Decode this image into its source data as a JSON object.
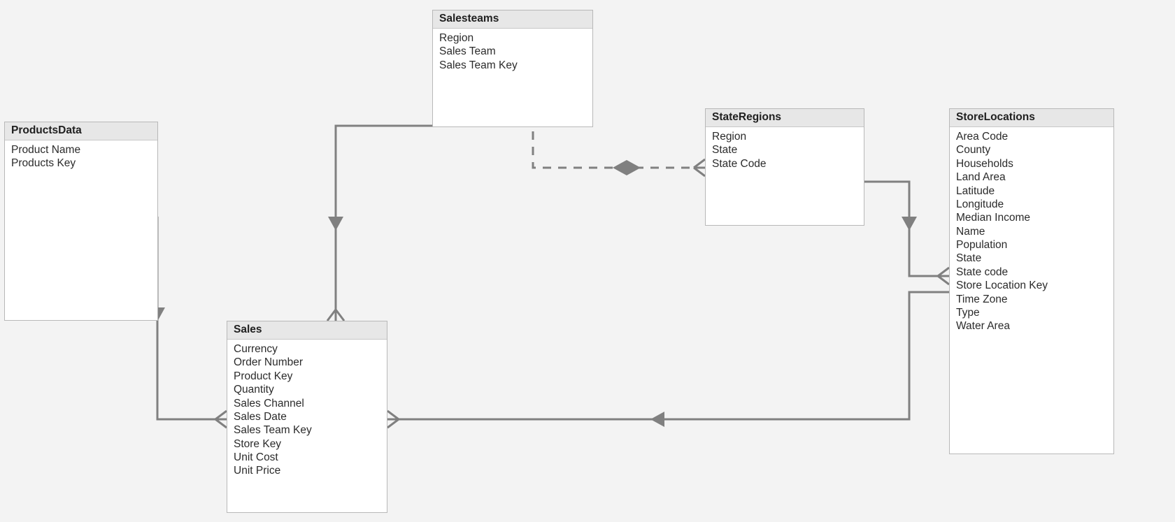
{
  "entities": {
    "productsData": {
      "title": "ProductsData",
      "fields": [
        "Product Name",
        "Products Key"
      ]
    },
    "salesteams": {
      "title": "Salesteams",
      "fields": [
        "Region",
        "Sales Team",
        "Sales Team Key"
      ]
    },
    "stateRegions": {
      "title": "StateRegions",
      "fields": [
        "Region",
        "State",
        "State Code"
      ]
    },
    "storeLocations": {
      "title": "StoreLocations",
      "fields": [
        "Area Code",
        "County",
        "Households",
        "Land Area",
        "Latitude",
        "Longitude",
        "Median Income",
        "Name",
        "Population",
        "State",
        "State code",
        "Store Location Key",
        "Time Zone",
        "Type",
        "Water Area"
      ]
    },
    "sales": {
      "title": "Sales",
      "fields": [
        "Currency",
        "Order Number",
        "Product Key",
        "Quantity",
        "Sales Channel",
        "Sales Date",
        "Sales Team Key",
        "Store Key",
        "Unit Cost",
        "Unit Price"
      ]
    }
  },
  "relationships": [
    {
      "from": "ProductsData",
      "to": "Sales",
      "style": "solid",
      "endMany": "Sales"
    },
    {
      "from": "Salesteams",
      "to": "Sales",
      "style": "solid",
      "endMany": "Sales"
    },
    {
      "from": "Salesteams",
      "to": "StateRegions",
      "style": "dashed",
      "endMany": "both"
    },
    {
      "from": "StoreLocations",
      "to": "Sales",
      "style": "solid",
      "endMany": "Sales"
    },
    {
      "from": "StateRegions",
      "to": "StoreLocations",
      "style": "solid",
      "endMany": "StoreLocations"
    }
  ],
  "colors": {
    "background": "#f3f3f3",
    "entityBg": "#ffffff",
    "entityHeaderBg": "#e7e7e7",
    "border": "#b8b8b8",
    "connector": "#808080"
  }
}
